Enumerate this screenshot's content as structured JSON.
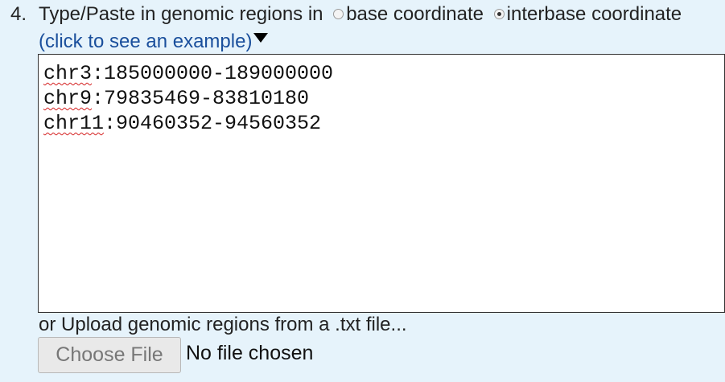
{
  "step": {
    "number": "4.",
    "heading": "Type/Paste in genomic regions in",
    "coordinate_options": [
      {
        "label": "base coordinate",
        "selected": false
      },
      {
        "label": "interbase coordinate",
        "selected": true
      }
    ],
    "example_link": "(click to see an example)",
    "example_toggle_icon": "triangle-down-icon"
  },
  "regions": {
    "lines": [
      {
        "chrom": "chr3",
        "range": ":185000000-189000000"
      },
      {
        "chrom": "chr9",
        "range": ":79835469-83810180"
      },
      {
        "chrom": "chr11",
        "range": ":90460352-94560352"
      }
    ]
  },
  "upload": {
    "label": "or Upload genomic regions from a .txt file...",
    "button_label": "Choose File",
    "status": "No file chosen"
  }
}
